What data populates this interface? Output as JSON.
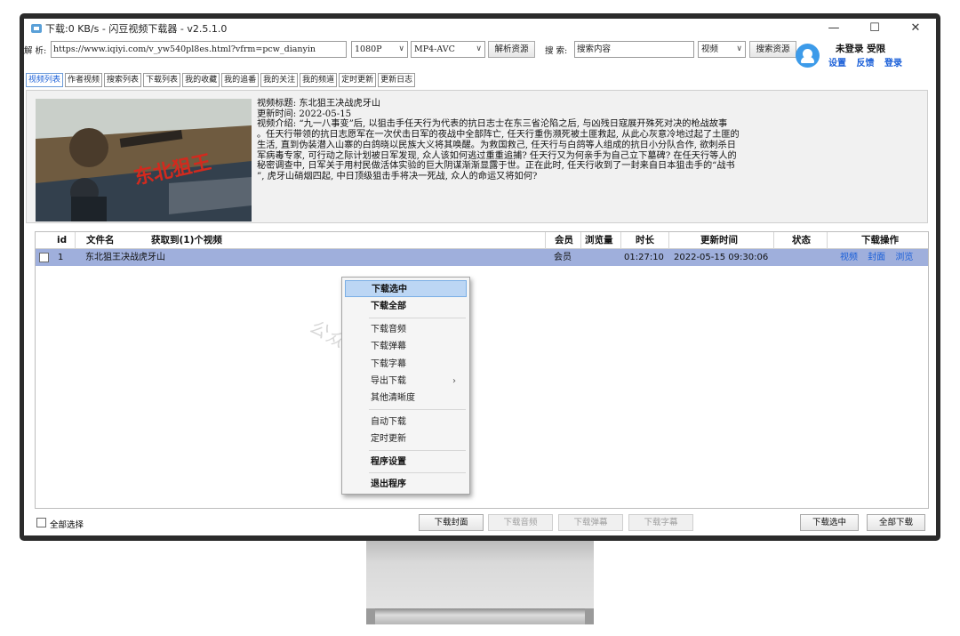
{
  "window": {
    "title": "下载:0 KB/s - 闪豆视频下载器 - v2.5.1.0",
    "controls": {
      "minimize": "—",
      "maximize": "☐",
      "close": "✕"
    }
  },
  "parse": {
    "label": "解 析:",
    "url": "https://www.iqiyi.com/v_yw540pl8es.html?vfrm=pcw_dianyin",
    "quality": "1080P",
    "format": "MP4-AVC",
    "parse_button": "解析资源"
  },
  "search": {
    "label": "搜 索:",
    "placeholder": "搜索内容",
    "type": "视频",
    "search_button": "搜索资源"
  },
  "user": {
    "status": "未登录 受限",
    "links": [
      "设置",
      "反馈",
      "登录"
    ]
  },
  "tabs": [
    "视频列表",
    "作者视频",
    "搜索列表",
    "下载列表",
    "我的收藏",
    "我的追番",
    "我的关注",
    "我的频道",
    "定时更新",
    "更新日志"
  ],
  "video": {
    "title_line": "视频标题: 东北狙王决战虎牙山",
    "time_line": "更新时间: 2022-05-15",
    "intro_lines": [
      "视频介绍: “九一八事变”后, 以狙击手任天行为代表的抗日志士在东三省沦陷之后, 与凶残日寇展开殊死对决的枪战故事",
      "。任天行带领的抗日志愿军在一次伏击日军的夜战中全部阵亡, 任天行重伤濒死被土匪救起, 从此心灰意冷地过起了土匪的",
      "生活, 直到伪装潜入山寨的白鸽晓以民族大义将其唤醒。为救国救己, 任天行与白鸽等人组成的抗日小分队合作, 欲刺杀日",
      "军病毒专家, 可行动之际计划被日军发现, 众人该如何逃过重重追捕? 任天行又为何亲手为自己立下墓碑? 在任天行等人的",
      "秘密调查中, 日军关于用村民做活体实验的巨大阴谋渐渐显露于世。正在此时, 任天行收到了一封来自日本狙击手的“战书",
      "”, 虎牙山硝烟四起, 中日顶级狙击手将决一死战, 众人的命运又将如何?"
    ],
    "poster_text": "东北狙王"
  },
  "table": {
    "headers": {
      "id": "id",
      "name": "文件名",
      "count": "获取到(1)个视频",
      "member": "会员",
      "views": "浏览量",
      "duration": "时长",
      "updated": "更新时间",
      "status": "状态",
      "actions": "下载操作"
    },
    "rows": [
      {
        "id": "1",
        "name": "东北狙王决战虎牙山",
        "member": "会员",
        "views": "",
        "duration": "01:27:10",
        "updated": "2022-05-15 09:30:06",
        "status": "",
        "actions": [
          "视频",
          "封面",
          "浏览"
        ]
      }
    ]
  },
  "context_menu": {
    "items": [
      {
        "label": "下载选中",
        "selected": true,
        "bold": true
      },
      {
        "label": "下载全部",
        "bold": true
      },
      {
        "label": "下载音频"
      },
      {
        "label": "下载弹幕"
      },
      {
        "label": "下载字幕"
      },
      {
        "label": "导出下载",
        "submenu_arrow": "›"
      },
      {
        "label": "其他清晰度"
      },
      {
        "label": "自动下载"
      },
      {
        "label": "定时更新"
      },
      {
        "label": "程序设置",
        "bold": true
      },
      {
        "label": "退出程序",
        "bold": true
      }
    ]
  },
  "watermark": "公众号：xxxStore",
  "bottom": {
    "select_all": "全部选择",
    "buttons": {
      "download_cover": "下载封面",
      "download_audio": "下载音频",
      "download_danmaku": "下载弹幕",
      "download_subtitle": "下载字幕",
      "download_selected": "下载选中",
      "download_all": "全部下载"
    }
  }
}
